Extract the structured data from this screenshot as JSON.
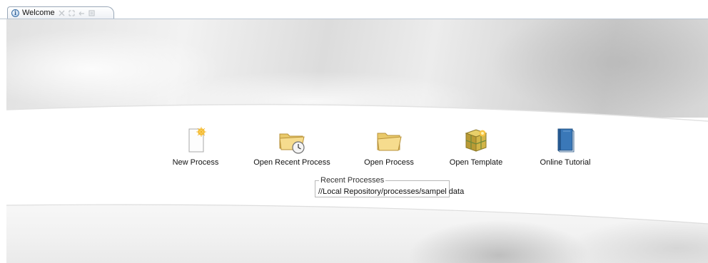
{
  "tab": {
    "title": "Welcome",
    "icon": "info-icon",
    "controls": [
      "close-icon",
      "maximize-icon",
      "undock-icon",
      "restore-icon"
    ]
  },
  "actions": [
    {
      "label": "New Process",
      "icon": "new-process-icon"
    },
    {
      "label": "Open Recent Process",
      "icon": "recent-folder-clock-icon"
    },
    {
      "label": "Open Process",
      "icon": "folder-icon"
    },
    {
      "label": "Open Template",
      "icon": "template-box-icon"
    },
    {
      "label": "Online Tutorial",
      "icon": "book-icon"
    }
  ],
  "recent": {
    "title": "Recent Processes",
    "items": [
      "//Local Repository/processes/sampel data"
    ]
  },
  "colors": {
    "folder": "#f3d98a",
    "book": "#3a78b8",
    "template": "#c9a83c",
    "star": "#f2b01e"
  }
}
